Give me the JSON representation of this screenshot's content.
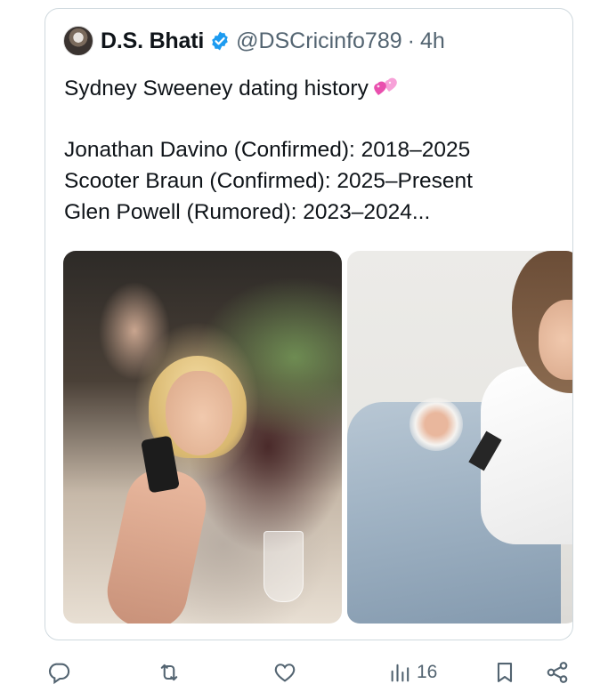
{
  "quoted_tweet": {
    "author_name": "D.S. Bhati",
    "handle": "@DSCricinfo789",
    "separator": "·",
    "timestamp": "4h",
    "verified": true,
    "text_lines": [
      "Sydney Sweeney dating history",
      "Jonathan Davino (Confirmed): 2018–2025",
      "Scooter Braun (Confirmed): 2025–Present",
      "Glen Powell (Rumored): 2023–2024..."
    ],
    "title_emoji": "two-hearts-icon",
    "images": [
      "photo-event-table",
      "photo-white-top-jeans"
    ]
  },
  "actions": {
    "reply_icon": "reply-icon",
    "repost_icon": "repost-icon",
    "like_icon": "like-icon",
    "views_icon": "views-icon",
    "views_count": "16",
    "bookmark_icon": "bookmark-icon",
    "share_icon": "share-icon"
  },
  "colors": {
    "text": "#0f1419",
    "secondary": "#536471",
    "verified": "#1d9bf0",
    "border": "#cfd9de"
  }
}
